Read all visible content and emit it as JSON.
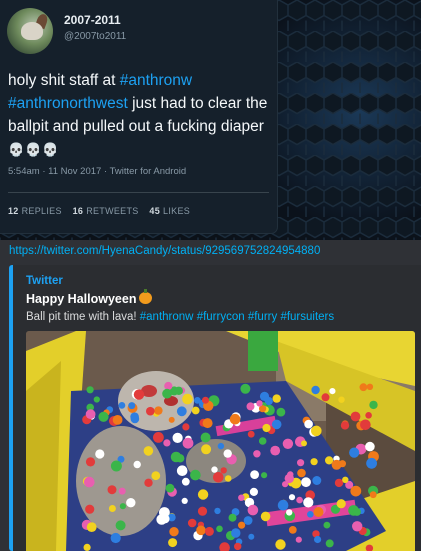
{
  "tweet": {
    "display_name": "2007-2011",
    "handle": "@2007to2011",
    "text_intro": "holy shit staff at ",
    "hashtag1": "#anthronw",
    "hashtag2": "#anthronorthwest",
    "text_rest": " just had to clear the ballpit and pulled out a fucking diaper ",
    "skulls": "💀💀💀",
    "meta": "5:54am · 11 Nov 2017 · Twitter for Android",
    "replies_count": "12",
    "replies_label": "REPLIES",
    "retweets_count": "16",
    "retweets_label": "RETWEETS",
    "likes_count": "45",
    "likes_label": "LIKES"
  },
  "message": {
    "link": "https://twitter.com/HyenaCandy/status/929569752824954880"
  },
  "embed": {
    "provider": "Twitter",
    "title": "Happy Hallowyeen",
    "desc_text": "Ball pit time with lava! ",
    "tags": [
      "#anthronw",
      "#furrycon",
      "#furry",
      "#fursuiters"
    ],
    "accent": "#1da1f2",
    "image_icon": "pumpkin-icon"
  },
  "colors": {
    "tweet_bg": "#15202b",
    "link": "#00b0f4",
    "hashtag": "#1da1f2"
  }
}
